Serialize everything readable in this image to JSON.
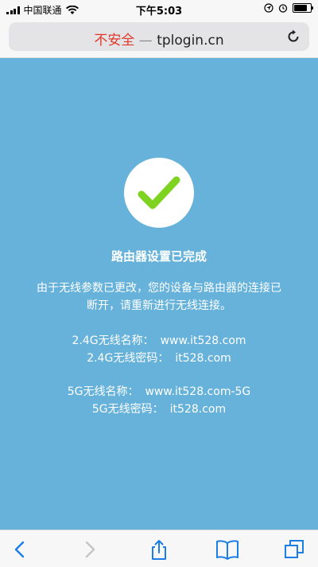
{
  "status_bar": {
    "carrier": "中国联通",
    "time": "下午5:03"
  },
  "address_bar": {
    "insecure_label": "不安全",
    "separator": "—",
    "domain": "tplogin.cn"
  },
  "main": {
    "title": "路由器设置已完成",
    "description": "由于无线参数已更改，您的设备与路由器的连接已断开，请重新进行无线连接。",
    "wifi_24g": {
      "name_label": "2.4G无线名称：",
      "name_value": "www.it528.com",
      "password_label": "2.4G无线密码：",
      "password_value": "it528.com"
    },
    "wifi_5g": {
      "name_label": "5G无线名称：",
      "name_value": "www.it528.com-5G",
      "password_label": "5G无线密码：",
      "password_value": "it528.com"
    }
  },
  "colors": {
    "content_background": "#66b2da",
    "insecure_text": "#e0392b",
    "checkmark": "#7ed321",
    "toolbar_icon": "#1a7ee6"
  },
  "icons": {
    "status": [
      "signal-icon",
      "wifi-icon",
      "location-icon",
      "alarm-icon",
      "battery-icon"
    ],
    "address": [
      "reload-icon"
    ],
    "toolbar": [
      "back-icon",
      "forward-icon",
      "share-icon",
      "bookmarks-icon",
      "tabs-icon"
    ],
    "content": [
      "checkmark-icon"
    ]
  }
}
